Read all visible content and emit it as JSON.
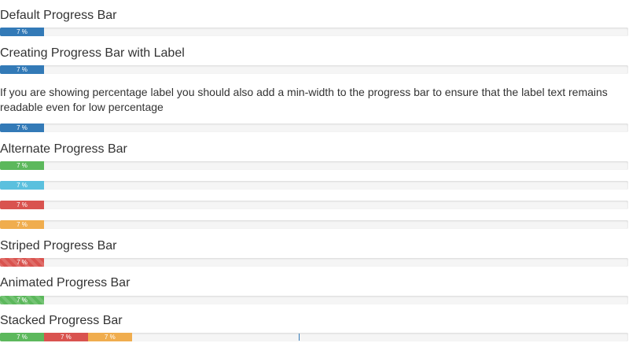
{
  "colors": {
    "default": "#337ab7",
    "success": "#5cb85c",
    "info": "#5bc0de",
    "danger": "#d9534f",
    "warning": "#f0ad4e",
    "track": "#f5f5f5",
    "text": "#333333"
  },
  "sections": {
    "default": {
      "title": "Default Progress Bar"
    },
    "label": {
      "title": "Creating Progress Bar with Label",
      "note": "If you are showing percentage label you should also add a min-width to the progress bar to ensure that the label text remains readable even for low percentage"
    },
    "alternate": {
      "title": "Alternate Progress Bar"
    },
    "striped": {
      "title": "Striped Progress Bar"
    },
    "animated": {
      "title": "Animated Progress Bar"
    },
    "stacked": {
      "title": "Stacked Progress Bar"
    }
  },
  "bars": {
    "default_bar": {
      "label": "7 %",
      "value_percent": 7,
      "color": "#337ab7"
    },
    "label_bar": {
      "label": "7 %",
      "value_percent": 7,
      "color": "#337ab7"
    },
    "minwidth_bar": {
      "label": "7 %",
      "value_percent": 7,
      "color": "#337ab7"
    },
    "alt_success": {
      "label": "7 %",
      "value_percent": 7,
      "color": "#5cb85c"
    },
    "alt_info": {
      "label": "7 %",
      "value_percent": 7,
      "color": "#5bc0de"
    },
    "alt_danger": {
      "label": "7 %",
      "value_percent": 7,
      "color": "#d9534f"
    },
    "alt_warning": {
      "label": "7 %",
      "value_percent": 7,
      "color": "#f0ad4e"
    },
    "striped_bar": {
      "label": "7 %",
      "value_percent": 7,
      "color": "#d9534f"
    },
    "animated_bar": {
      "label": "7 %",
      "value_percent": 7,
      "color": "#5cb85c"
    },
    "stacked": [
      {
        "label": "7 %",
        "value_percent": 7,
        "color": "#5cb85c"
      },
      {
        "label": "7 %",
        "value_percent": 7,
        "color": "#d9534f"
      },
      {
        "label": "7 %",
        "value_percent": 7,
        "color": "#f0ad4e"
      }
    ]
  }
}
